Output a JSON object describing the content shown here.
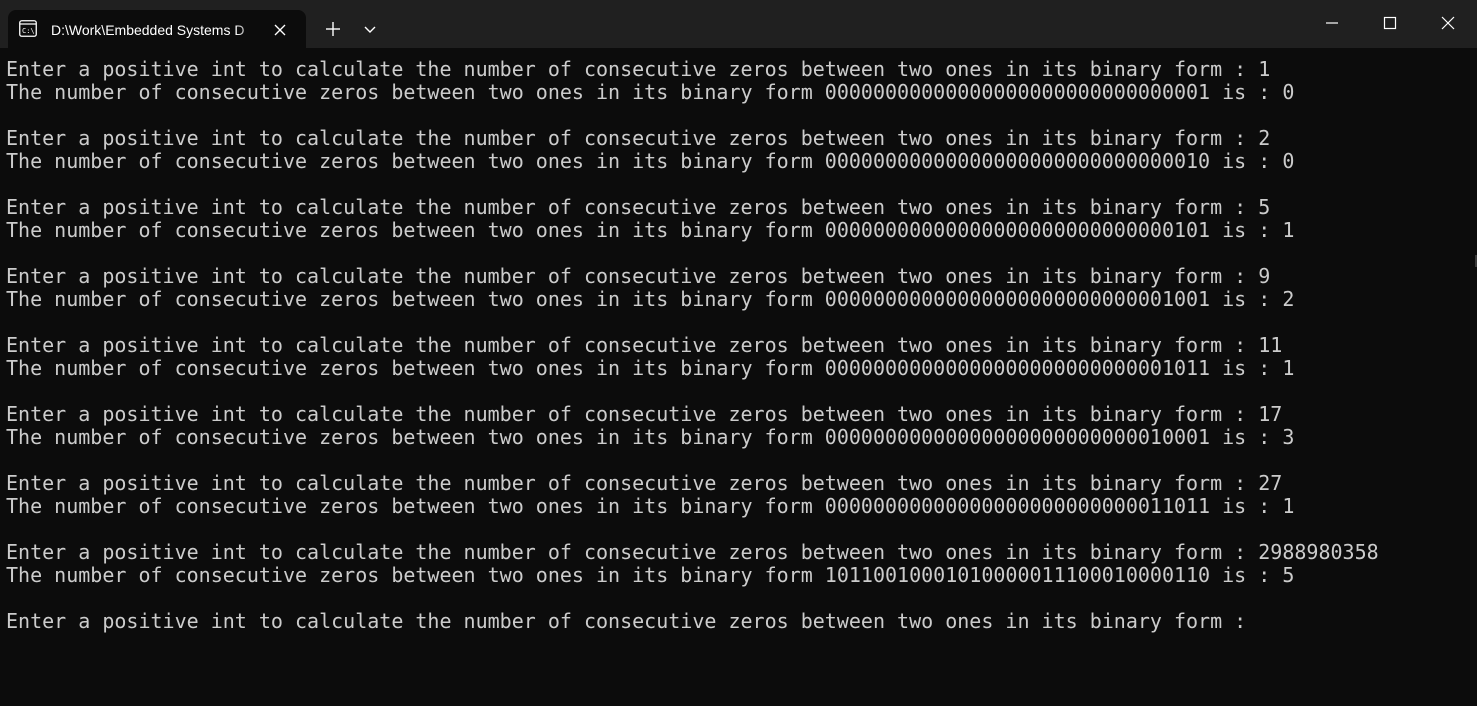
{
  "window": {
    "tab_title": "D:\\Work\\Embedded Systems D",
    "tab_icon": "terminal-icon",
    "colors": {
      "titlebar": "#202020",
      "background": "#0c0c0c",
      "text": "#cccccc"
    }
  },
  "titlebar": {
    "new_tab_icon": "plus-icon",
    "dropdown_icon": "chevron-down-icon",
    "minimize_icon": "minimize-icon",
    "maximize_icon": "maximize-icon",
    "close_icon": "close-icon"
  },
  "console": {
    "lines": [
      "Enter a positive int to calculate the number of consecutive zeros between two ones in its binary form : 1",
      "The number of consecutive zeros between two ones in its binary form 00000000000000000000000000000001 is : 0",
      "",
      "Enter a positive int to calculate the number of consecutive zeros between two ones in its binary form : 2",
      "The number of consecutive zeros between two ones in its binary form 00000000000000000000000000000010 is : 0",
      "",
      "Enter a positive int to calculate the number of consecutive zeros between two ones in its binary form : 5",
      "The number of consecutive zeros between two ones in its binary form 00000000000000000000000000000101 is : 1",
      "",
      "Enter a positive int to calculate the number of consecutive zeros between two ones in its binary form : 9",
      "The number of consecutive zeros between two ones in its binary form 00000000000000000000000000001001 is : 2",
      "",
      "Enter a positive int to calculate the number of consecutive zeros between two ones in its binary form : 11",
      "The number of consecutive zeros between two ones in its binary form 00000000000000000000000000001011 is : 1",
      "",
      "Enter a positive int to calculate the number of consecutive zeros between two ones in its binary form : 17",
      "The number of consecutive zeros between two ones in its binary form 00000000000000000000000000010001 is : 3",
      "",
      "Enter a positive int to calculate the number of consecutive zeros between two ones in its binary form : 27",
      "The number of consecutive zeros between two ones in its binary form 00000000000000000000000000011011 is : 1",
      "",
      "Enter a positive int to calculate the number of consecutive zeros between two ones in its binary form : 2988980358",
      "The number of consecutive zeros between two ones in its binary form 10110010001010000011100010000110 is : 5",
      "",
      "Enter a positive int to calculate the number of consecutive zeros between two ones in its binary form : "
    ]
  }
}
